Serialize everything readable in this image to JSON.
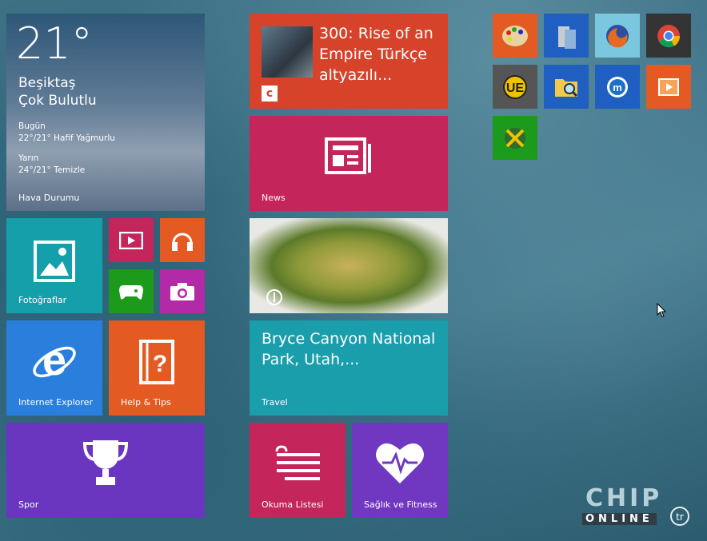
{
  "weather": {
    "temperature": "21°",
    "city": "Beşiktaş",
    "condition": "Çok Bulutlu",
    "today_label": "Bugün",
    "today_forecast": "22°/21° Hafif Yağmurlu",
    "tomorrow_label": "Yarın",
    "tomorrow_forecast": "24°/21° Temizle",
    "app_label": "Hava Durumu"
  },
  "tiles": {
    "photos": "Fotoğraflar",
    "ie": "Internet Explorer",
    "help": "Help & Tips",
    "sport": "Spor",
    "news": "News",
    "travel": "Travel",
    "reading": "Okuma Listesi",
    "health": "Sağlık ve Fitness"
  },
  "news_item": {
    "headline": "300: Rise of an Empire Türkçe altyazılı..."
  },
  "travel_item": {
    "headline": "Bryce Canyon National Park, Utah,..."
  },
  "watermark": {
    "big": "CHIP",
    "small": "ONLINE",
    "tr": "tr"
  },
  "desktop_app_icons": [
    "paint-icon",
    "server-icon",
    "firefox-icon",
    "chrome-icon",
    "ultraedit-icon",
    "file-search-icon",
    "maxthon-icon",
    "media-player-icon",
    "xbox-game-icon"
  ]
}
